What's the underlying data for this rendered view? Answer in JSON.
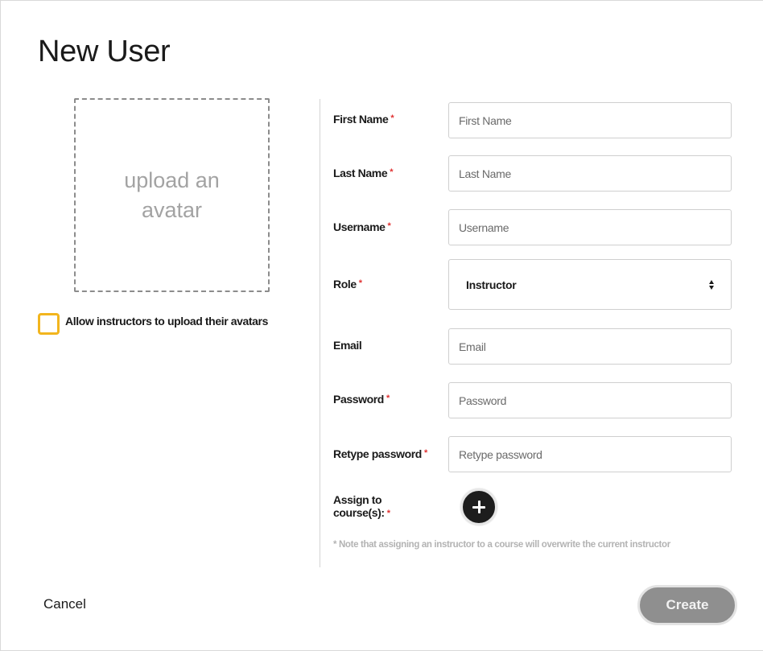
{
  "dialog": {
    "title": "New User"
  },
  "avatar": {
    "upload_label": "upload an avatar",
    "allow_instructors_label": "Allow instructors to upload their avatars",
    "allow_instructors_checked": false
  },
  "form": {
    "required_marker": "*",
    "first_name": {
      "label": "First Name",
      "placeholder": "First Name",
      "value": ""
    },
    "last_name": {
      "label": "Last Name",
      "placeholder": "Last Name",
      "value": ""
    },
    "username": {
      "label": "Username",
      "placeholder": "Username",
      "value": ""
    },
    "role": {
      "label": "Role",
      "selected": "Instructor"
    },
    "email": {
      "label": "Email",
      "placeholder": "Email",
      "value": ""
    },
    "password": {
      "label": "Password",
      "placeholder": "Password",
      "value": ""
    },
    "retype_password": {
      "label": "Retype password",
      "placeholder": "Retype password",
      "value": ""
    },
    "assign_courses": {
      "label_line1": "Assign to",
      "label_line2": "course(s):"
    },
    "note": "* Note that assigning an instructor to a course will overwrite the current instructor"
  },
  "footer": {
    "cancel_label": "Cancel",
    "create_label": "Create"
  },
  "colors": {
    "checkbox_border": "#f2b51e",
    "required_marker": "#e03232",
    "create_button_bg": "#8f8f8f",
    "add_button_bg": "#1d1d1d"
  },
  "icons": {
    "add_course": "plus-icon",
    "role_select": "select-arrows-icon"
  }
}
